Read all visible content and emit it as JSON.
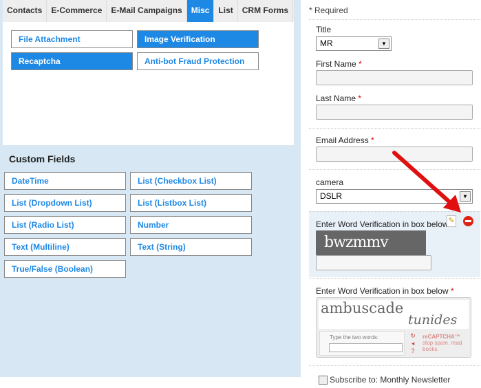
{
  "tabs": [
    "Contacts",
    "E-Commerce",
    "E-Mail Campaigns",
    "Misc",
    "List",
    "CRM Forms"
  ],
  "active_tab": "Misc",
  "misc_buttons": [
    "File Attachment",
    "Image Verification",
    "Recaptcha",
    "Anti-bot Fraud Protection"
  ],
  "custom_fields": {
    "title": "Custom Fields",
    "items": [
      "DateTime",
      "List (Checkbox List)",
      "List (Dropdown List)",
      "List (Listbox List)",
      "List (Radio List)",
      "Number",
      "Text (Multiline)",
      "Text (String)",
      "True/False (Boolean)"
    ]
  },
  "form": {
    "required_note": "* Required",
    "title_label": "Title",
    "title_value": "MR",
    "first_name_label": "First Name",
    "last_name_label": "Last Name",
    "email_label": "Email Address",
    "camera_label": "camera",
    "camera_value": "DSLR",
    "word_verif_label": "Enter Word Verification in box below",
    "captcha_text": "bwzmmv",
    "recaptcha_label": "Enter Word Verification in box below",
    "recaptcha_words": [
      "ambuscade",
      "tunides"
    ],
    "recaptcha_prompt": "Type the two words:",
    "recaptcha_brand": "reCAPTCHA™",
    "recaptcha_tagline": "stop spam. read books.",
    "asterisk": "*",
    "subscribe_label": "Subscribe to: Monthly Newsletter"
  },
  "colors": {
    "accent": "#1e88e5",
    "arrow": "#e01010"
  }
}
